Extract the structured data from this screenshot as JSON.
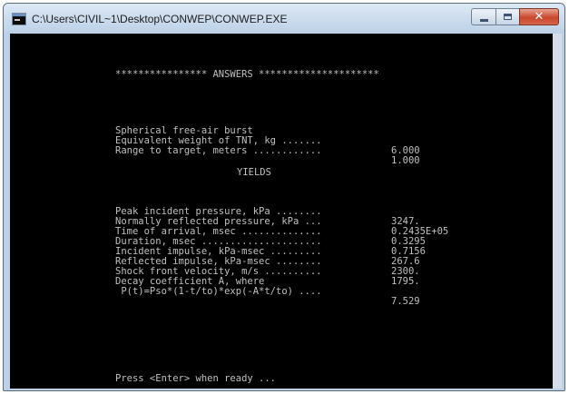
{
  "window": {
    "title": "C:\\Users\\CIVIL~1\\Desktop\\CONWEP\\CONWEP.EXE"
  },
  "console": {
    "header": "**************** ANSWERS *********************",
    "lines": [
      {
        "label": "Spherical free-air burst",
        "value": ""
      },
      {
        "label": "Equivalent weight of TNT, kg .......",
        "value": "6.000"
      },
      {
        "label": "Range to target, meters ............",
        "value": "1.000"
      }
    ],
    "yields_title": "YIELDS",
    "results": [
      {
        "label": "Peak incident pressure, kPa ........",
        "value": "3247."
      },
      {
        "label": "Normally reflected pressure, kPa ...",
        "value": "0.2435E+05"
      },
      {
        "label": "Time of arrival, msec ..............",
        "value": "0.3295"
      },
      {
        "label": "Duration, msec .....................",
        "value": "0.7156"
      },
      {
        "label": "Incident impulse, kPa-msec .........",
        "value": "267.6"
      },
      {
        "label": "Reflected impulse, kPa-msec ........",
        "value": "2300."
      },
      {
        "label": "Shock front velocity, m/s ..........",
        "value": "1795."
      },
      {
        "label": "Decay coefficient A, where",
        "value": ""
      },
      {
        "label": " P(t)=Pso*(1-t/to)*exp(-A*t/to) ....",
        "value": "7.529"
      }
    ],
    "prompt": "Press <Enter> when ready ..."
  },
  "colors": {
    "console_bg": "#000000",
    "console_text": "#c0c0c0",
    "titlebar": "#bcd0e6",
    "close_button": "#c9472b"
  },
  "icons": {
    "app": "console-app-icon",
    "minimize": "minimize-icon",
    "maximize": "maximize-icon",
    "close": "close-icon"
  }
}
